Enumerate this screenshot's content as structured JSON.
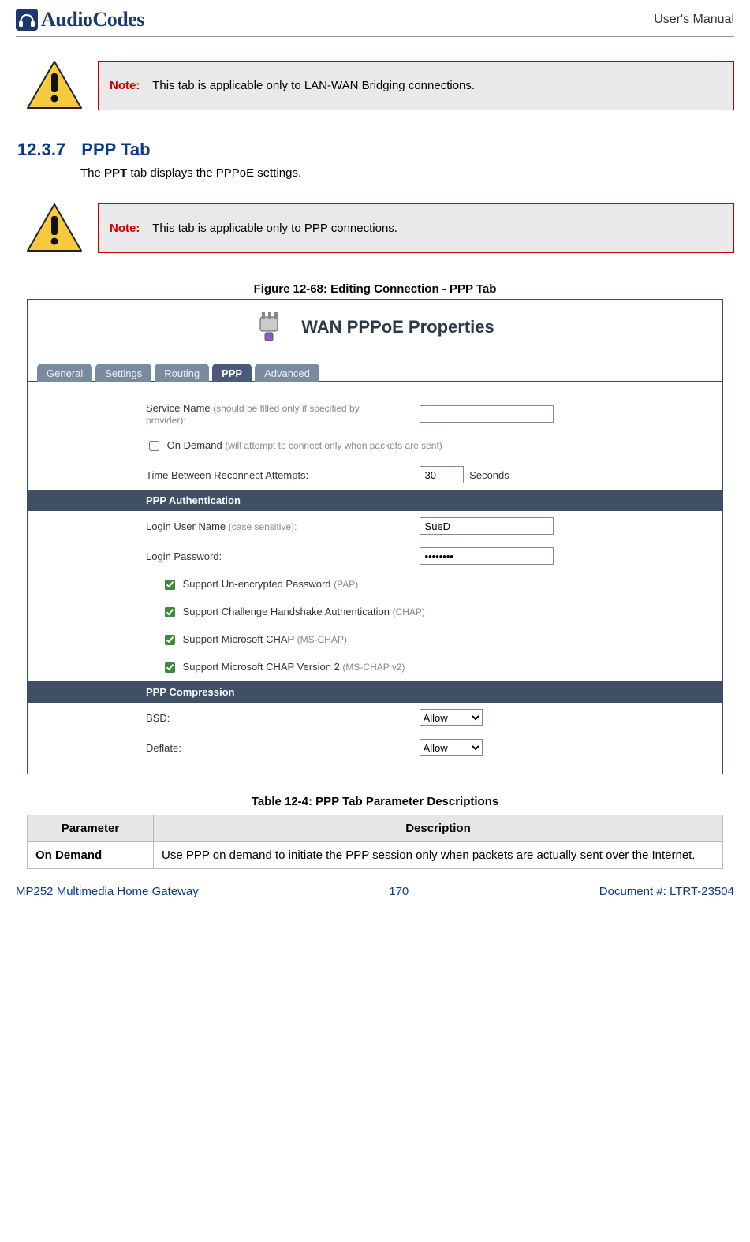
{
  "header": {
    "brand": "AudioCodes",
    "right": "User's Manual"
  },
  "notes": [
    {
      "label": "Note:",
      "text": "This tab is applicable only to LAN-WAN Bridging connections."
    },
    {
      "label": "Note:",
      "text": "This tab is applicable only to PPP connections."
    }
  ],
  "section": {
    "number": "12.3.7",
    "title": "PPP Tab",
    "intro_prefix": "The ",
    "intro_bold": "PPT",
    "intro_suffix": " tab displays the PPPoE settings."
  },
  "figure": {
    "caption": "Figure 12-68: Editing Connection - PPP Tab",
    "title": "WAN PPPoE Properties",
    "tabs": [
      "General",
      "Settings",
      "Routing",
      "PPP",
      "Advanced"
    ],
    "active_tab": "PPP",
    "form": {
      "service_name_label": "Service Name ",
      "service_name_hint": "(should be filled only if specified by provider):",
      "service_name_value": "",
      "on_demand_label": "On Demand ",
      "on_demand_hint": "(will attempt to connect only when packets are sent)",
      "on_demand_checked": false,
      "reconnect_label": "Time Between Reconnect Attempts:",
      "reconnect_value": "30",
      "reconnect_unit": "Seconds",
      "auth_header": "PPP Authentication",
      "login_user_label": "Login User Name ",
      "login_user_hint": "(case sensitive):",
      "login_user_value": "SueD",
      "login_pass_label": "Login Password:",
      "login_pass_value": "••••••••",
      "pap_label": "Support Un-encrypted Password ",
      "pap_hint": "(PAP)",
      "chap_label": "Support Challenge Handshake Authentication ",
      "chap_hint": "(CHAP)",
      "mschap_label": "Support Microsoft CHAP ",
      "mschap_hint": "(MS-CHAP)",
      "mschap2_label": "Support Microsoft CHAP Version 2 ",
      "mschap2_hint": "(MS-CHAP v2)",
      "comp_header": "PPP Compression",
      "bsd_label": "BSD:",
      "bsd_value": "Allow",
      "deflate_label": "Deflate:",
      "deflate_value": "Allow"
    }
  },
  "table": {
    "caption": "Table 12-4: PPP Tab Parameter Descriptions",
    "headers": [
      "Parameter",
      "Description"
    ],
    "rows": [
      {
        "param": "On Demand",
        "desc": "Use PPP on demand to initiate the PPP session only when packets are actually sent over the Internet."
      }
    ]
  },
  "footer": {
    "left": "MP252 Multimedia Home Gateway",
    "center": "170",
    "right": "Document #: LTRT-23504"
  }
}
